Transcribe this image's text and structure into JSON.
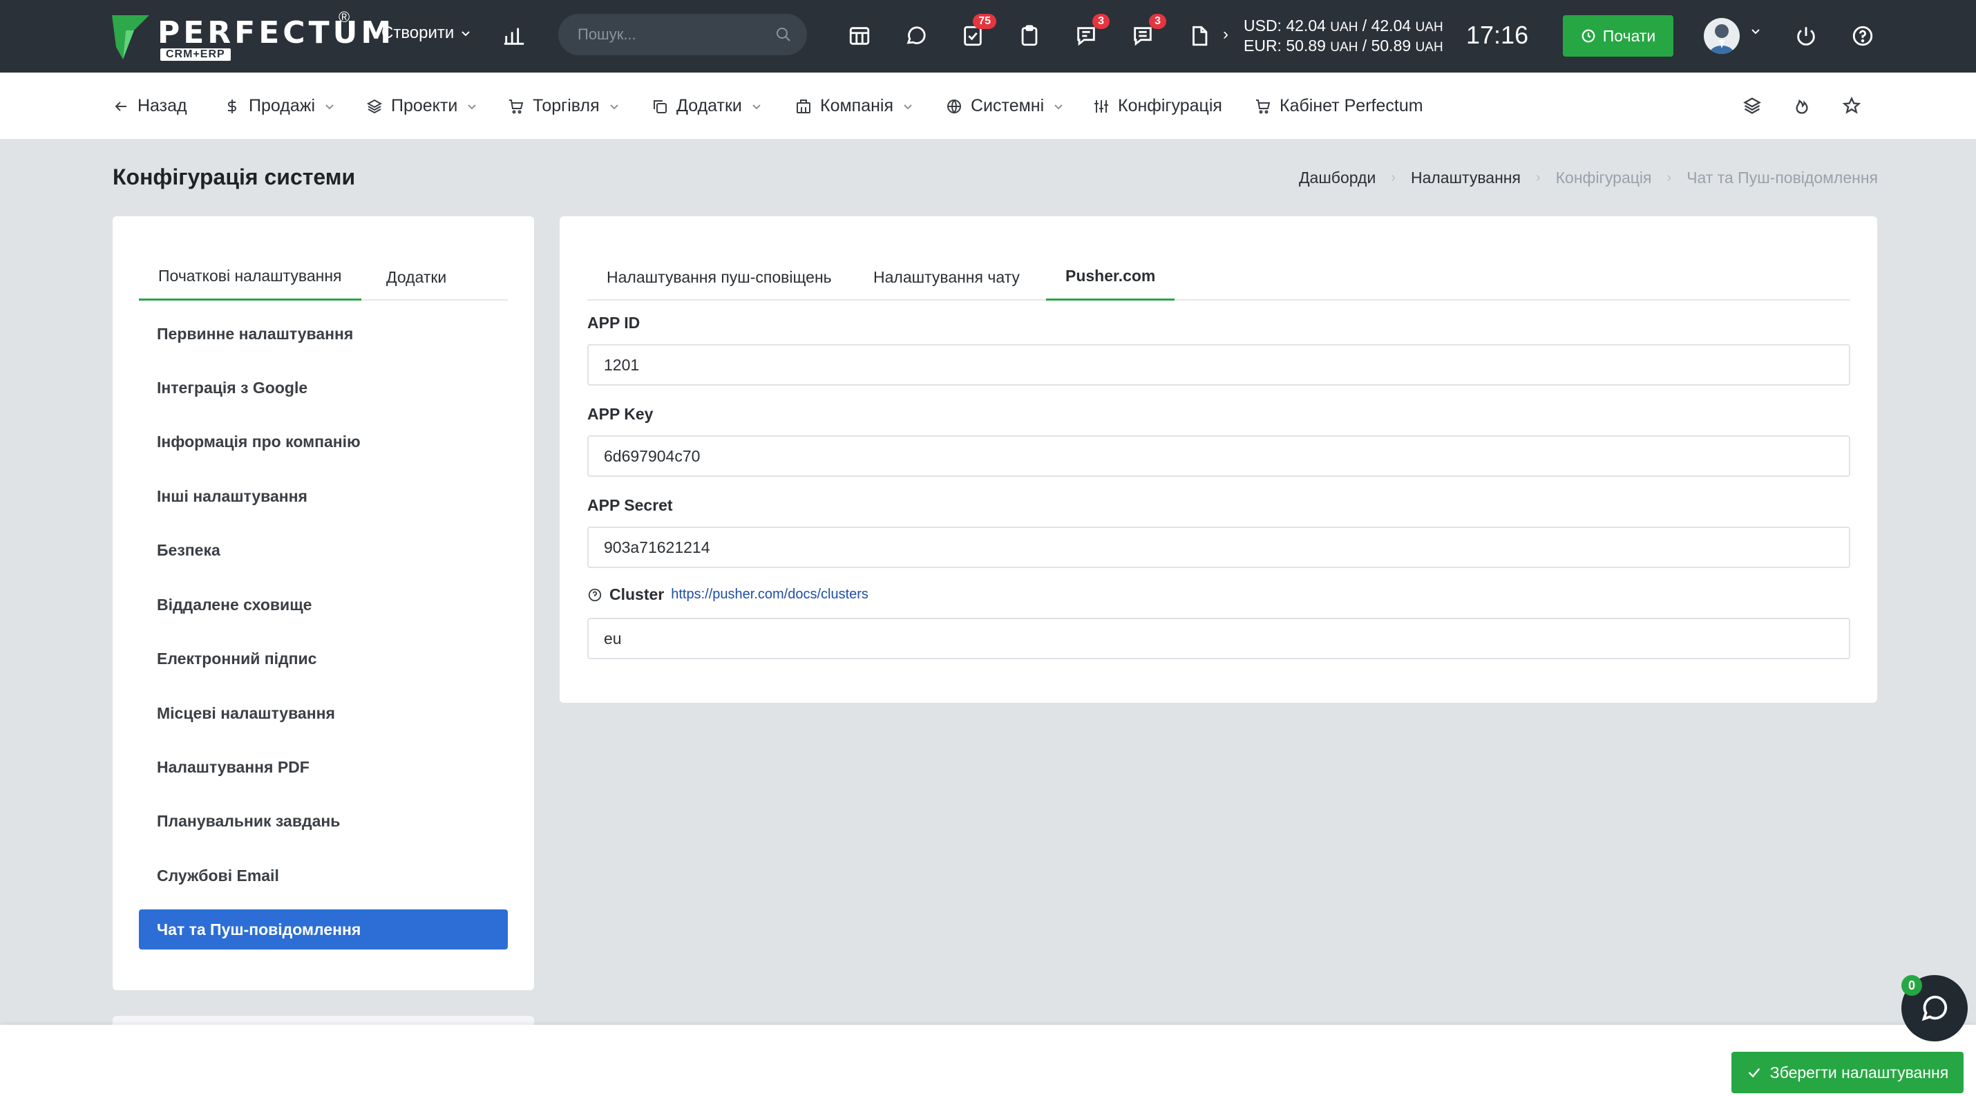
{
  "app": {
    "brand": "PERFECTUM",
    "brand_sub": "CRM+ERP",
    "brand_reg": "®"
  },
  "topbar": {
    "create_label": "Створити",
    "search_placeholder": "Пошук...",
    "badges": {
      "tasks": "75",
      "chat": "3",
      "messages": "3"
    },
    "usd_line": "USD: 42.04",
    "usd_unit1": "UAH",
    "usd_mid": " / 42.04 ",
    "usd_unit2": "UAH",
    "eur_line": "EUR: 50.89",
    "eur_unit1": "UAH",
    "eur_mid": " / 50.89 ",
    "eur_unit2": "UAH",
    "time": "17:16",
    "start_label": "Почати"
  },
  "nav": {
    "back": "Назад",
    "sales": "Продажі",
    "projects": "Проекти",
    "trade": "Торгівля",
    "addons": "Додатки",
    "company": "Компанія",
    "system": "Системні",
    "config": "Конфігурація",
    "cabinet": "Кабінет Perfectum"
  },
  "page": {
    "title": "Конфігурація системи",
    "breadcrumb": [
      "Дашборди",
      "Налаштування",
      "Конфігурація",
      "Чат та Пуш-повідомлення"
    ]
  },
  "left": {
    "tabs": [
      "Початкові налаштування",
      "Додатки"
    ],
    "items": [
      "Первинне налаштування",
      "Інтеграція з Google",
      "Інформація про компанію",
      "Інші налаштування",
      "Безпека",
      "Віддалене сховище",
      "Електронний підпис",
      "Місцеві налаштування",
      "Налаштування PDF",
      "Планувальник завдань",
      "Службові Email",
      "Чат та Пуш-повідомлення"
    ]
  },
  "right": {
    "tabs": [
      "Налаштування пуш-сповіщень",
      "Налаштування чату",
      "Pusher.com"
    ],
    "fields": {
      "app_id_label": "APP ID",
      "app_id_value": "1201",
      "app_key_label": "APP Key",
      "app_key_value": "6d697904c70",
      "app_secret_label": "APP Secret",
      "app_secret_value": "903a71621214",
      "cluster_label": "Cluster",
      "cluster_link": "https://pusher.com/docs/clusters",
      "cluster_value": "eu"
    }
  },
  "footer": {
    "save_label": "Зберегти налаштування",
    "chat_count": "0"
  },
  "colors": {
    "topbar": "#2a3139",
    "accent_green": "#27a744",
    "active_blue": "#2c6ed5",
    "badge_red": "#e5353f"
  }
}
